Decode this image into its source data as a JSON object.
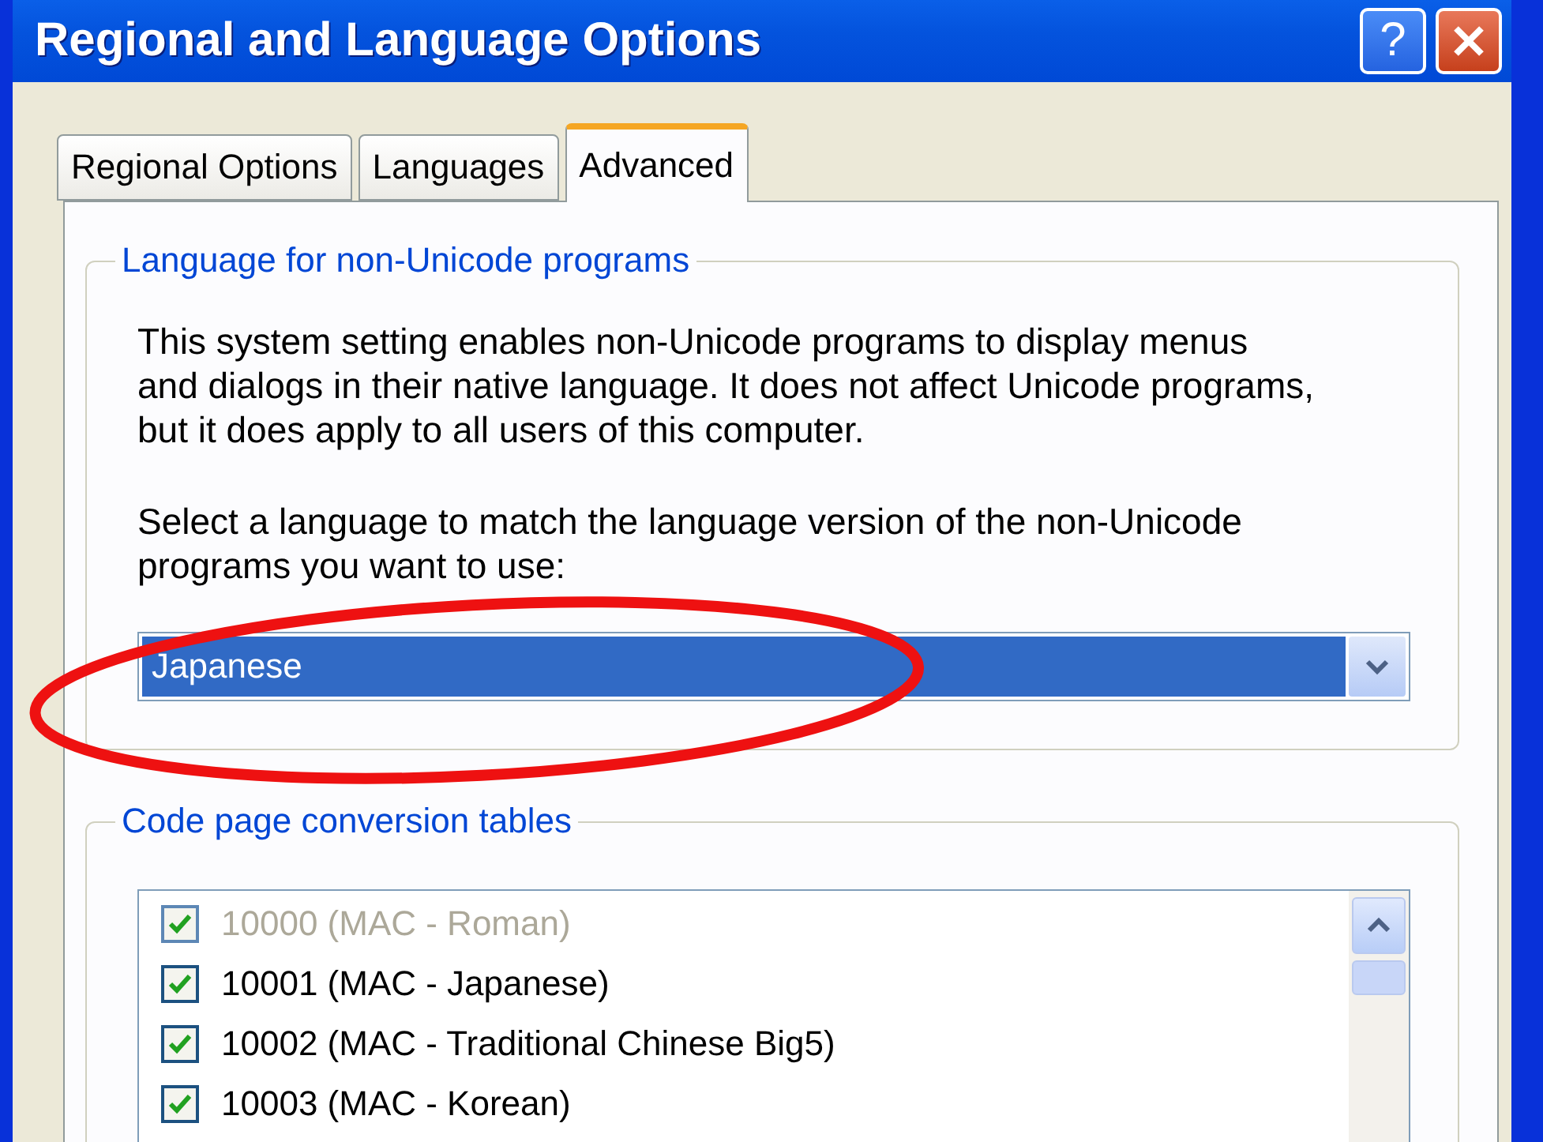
{
  "window": {
    "title": "Regional and Language Options",
    "help_label": "?"
  },
  "tabs": [
    {
      "label": "Regional Options",
      "selected": false
    },
    {
      "label": "Languages",
      "selected": false
    },
    {
      "label": "Advanced",
      "selected": true
    }
  ],
  "non_unicode_group": {
    "title": "Language for non-Unicode programs",
    "description": "This system setting enables non-Unicode programs to display menus and dialogs in their native language. It does not affect Unicode programs, but it does apply to all users of this computer.",
    "prompt": "Select a language to match the language version of the non-Unicode programs you want to use:",
    "language_dropdown": {
      "value": "Japanese"
    }
  },
  "code_page_group": {
    "title": "Code page conversion tables",
    "items": [
      {
        "label": "10000 (MAC - Roman)",
        "checked": true,
        "disabled": true
      },
      {
        "label": "10001 (MAC - Japanese)",
        "checked": true,
        "disabled": false
      },
      {
        "label": "10002 (MAC - Traditional Chinese Big5)",
        "checked": true,
        "disabled": false
      },
      {
        "label": "10003 (MAC - Korean)",
        "checked": true,
        "disabled": false
      }
    ]
  }
}
